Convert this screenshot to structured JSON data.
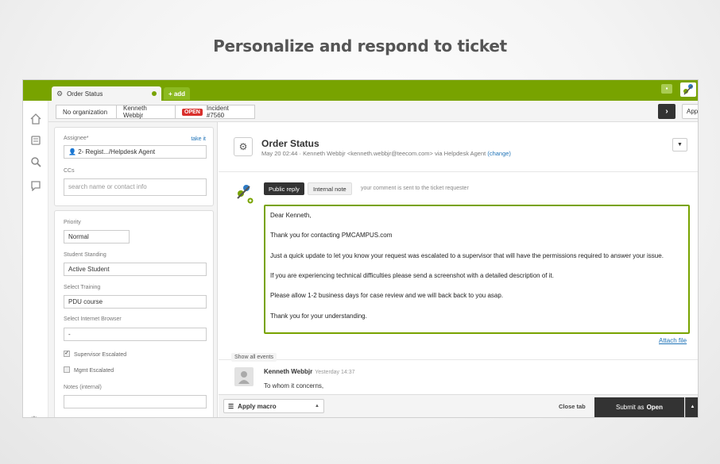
{
  "headline": "Personalize and respond to ticket",
  "colors": {
    "brand_green": "#78a300",
    "link_blue": "#1f73b7",
    "open_red": "#d9302c",
    "dark": "#333333"
  },
  "tabs": {
    "active_label": "Order Status",
    "add_label": "+ add"
  },
  "rail": {
    "icons": [
      "home-icon",
      "views-icon",
      "search-icon",
      "reporting-icon",
      "settings-icon"
    ]
  },
  "breadcrumbs": {
    "organization": "No organization",
    "requester": "Kenneth Webbjr",
    "status_badge": "OPEN",
    "incident": "Incident #7560"
  },
  "apps_label": "Apps",
  "sidebar": {
    "assignee_label": "Assignee*",
    "take_it": "take it",
    "assignee_value": "2- Regist.../Helpdesk Agent",
    "ccs_label": "CCs",
    "ccs_placeholder": "search name or contact info",
    "priority_label": "Priority",
    "priority_value": "Normal",
    "standing_label": "Student Standing",
    "standing_value": "Active Student",
    "training_label": "Select Training",
    "training_value": "PDU course",
    "browser_label": "Select Internet Browser",
    "browser_value": "-",
    "supervisor_label": "Supervisor Escalated",
    "mgmt_label": "Mgmt Escalated",
    "notes_label": "Notes (internal)",
    "notes_value": ""
  },
  "ticket": {
    "subject": "Order Status",
    "meta_prefix": "May 20 02:44  ·  Kenneth Webbjr <kenneth.webbjr@teecom.com> via Helpdesk Agent",
    "change_label": "(change)"
  },
  "reply": {
    "public_label": "Public reply",
    "internal_label": "Internal note",
    "note": "your comment is sent to the ticket requester",
    "lines": [
      "Dear Kenneth,",
      "Thank you for contacting PMCAMPUS.com",
      "Just a quick update to let you know your request was escalated to a supervisor that will have the permissions required to answer your issue.",
      "If you are experiencing technical difficulties please send a screenshot with a detailed description of it.",
      "Please allow 1-2 business days for case review and we will back back to you asap.",
      "Thank you for your understanding."
    ],
    "attach_label": "Attach file"
  },
  "events": {
    "show_all_label": "Show all events",
    "author": "Kenneth Webbjr",
    "time": "Yesterday 14:37",
    "body": "To whom it concerns,"
  },
  "footer": {
    "macro_label": "Apply macro",
    "close_tab_label": "Close tab",
    "submit_prefix": "Submit as",
    "submit_status": "Open"
  }
}
